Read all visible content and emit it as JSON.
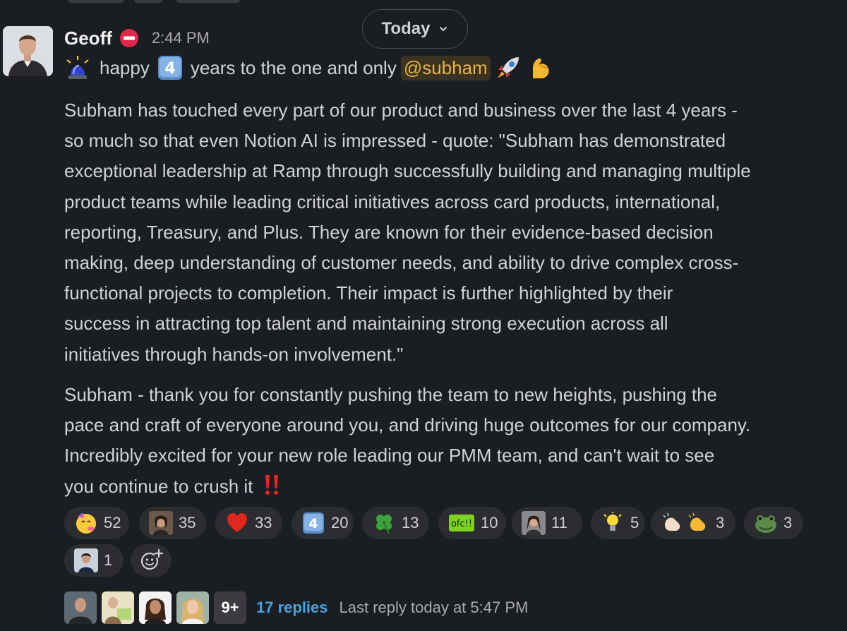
{
  "divider": {
    "label": "Today",
    "chevron_icon": "chevron-down-icon"
  },
  "message": {
    "sender": "Geoff",
    "status_icon": "no-entry-icon",
    "time": "2:44 PM",
    "line1": {
      "lead_icon": "police-light-icon",
      "word1": "happy",
      "keycap_icon": "keycap-4-icon",
      "word2": "years to the one and only",
      "mention": "@subham",
      "trail_icons": [
        "rocket-icon",
        "flexed-biceps-icon"
      ]
    },
    "paragraph1": [
      "Subham has touched every part of our product and business over the last 4 years -",
      "so much so that even Notion AI is impressed - quote: \"Subham has demonstrated",
      "exceptional leadership at Ramp through successfully building and managing multiple",
      "product teams while leading critical initiatives across card products, international,",
      "reporting, Treasury, and Plus. They are known for their evidence-based decision",
      "making, deep understanding of customer needs, and ability to drive complex cross-",
      "functional projects to completion. Their impact is further highlighted by their",
      "success in attracting top talent and maintaining strong execution across all",
      "initiatives through hands-on involvement.\""
    ],
    "paragraph2": [
      "Subham - thank you for constantly pushing the team to new heights, pushing the",
      "pace and craft of everyone around you, and driving huge outcomes for our company.",
      "Incredibly excited for your new role leading our PMM team, and can't wait to see",
      "you continue to crush it"
    ],
    "paragraph2_trail_icon": "double-exclamation-icon"
  },
  "reactions": [
    {
      "icon": "partying-face-icon",
      "count": "52"
    },
    {
      "icon": "custom-photo-emoji-icon",
      "count": "35"
    },
    {
      "icon": "red-heart-icon",
      "count": "33"
    },
    {
      "icon": "keycap-4-icon",
      "count": "20"
    },
    {
      "icon": "four-leaf-clover-icon",
      "count": "13"
    },
    {
      "icon": "ofc-custom-emoji-icon",
      "count": "10",
      "label": "ofc!!"
    },
    {
      "icon": "custom-photo-emoji-icon",
      "count": "11"
    },
    {
      "icon": "light-bulb-icon",
      "count": "5"
    },
    {
      "icon": "clapping-hands-icon",
      "count": "3"
    },
    {
      "icon": "frog-custom-emoji-icon",
      "count": "3"
    },
    {
      "icon": "custom-photo-emoji-icon",
      "count": "1"
    }
  ],
  "add_reaction_icon": "add-reaction-icon",
  "thread": {
    "more_count": "9+",
    "replies": "17 replies",
    "last_reply": "Last reply today at 5:47 PM"
  },
  "colors": {
    "background": "#1a1d21",
    "text": "#d1d2d3",
    "mention_bg": "#3b3322",
    "mention_text": "#e8b442",
    "link": "#4aa3df",
    "pill_bg": "#2b2d31"
  }
}
